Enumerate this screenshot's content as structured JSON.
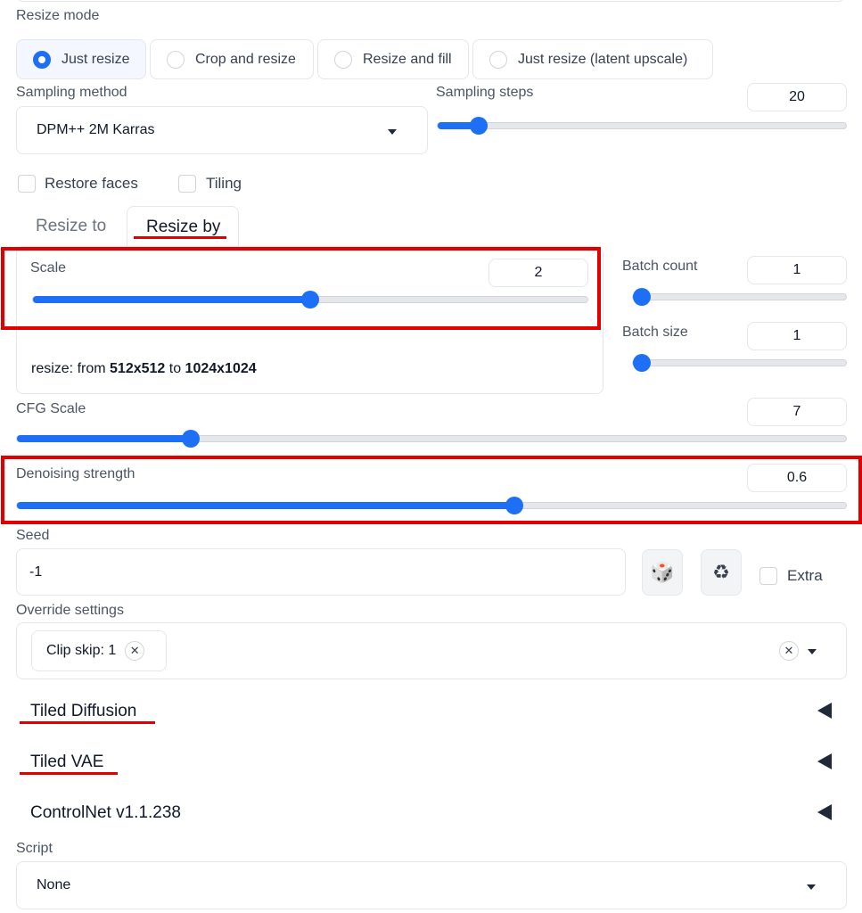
{
  "resize_mode": {
    "label": "Resize mode",
    "options": [
      "Just resize",
      "Crop and resize",
      "Resize and fill",
      "Just resize (latent upscale)"
    ],
    "selected_index": 0
  },
  "sampling_method": {
    "label": "Sampling method",
    "value": "DPM++ 2M Karras"
  },
  "sampling_steps": {
    "label": "Sampling steps",
    "value": "20",
    "fraction": 0.1
  },
  "checkboxes": {
    "restore_faces": "Restore faces",
    "tiling": "Tiling"
  },
  "resize_tabs": {
    "tab1": "Resize to",
    "tab2": "Resize by",
    "active": "Resize by"
  },
  "scale": {
    "label": "Scale",
    "value": "2",
    "fraction": 0.5
  },
  "resize_info": {
    "prefix": "resize: from ",
    "from": "512x512",
    "mid": " to ",
    "to": "1024x1024"
  },
  "batch_count": {
    "label": "Batch count",
    "value": "1",
    "fraction": 0.0
  },
  "batch_size": {
    "label": "Batch size",
    "value": "1",
    "fraction": 0.0
  },
  "cfg_scale": {
    "label": "CFG Scale",
    "value": "7",
    "fraction": 0.21
  },
  "denoising": {
    "label": "Denoising strength",
    "value": "0.6",
    "fraction": 0.6
  },
  "seed": {
    "label": "Seed",
    "value": "-1",
    "dice_icon": "🎲",
    "recycle_icon": "♻"
  },
  "extra": {
    "label": "Extra"
  },
  "override": {
    "label": "Override settings",
    "tag": "Clip skip: 1",
    "tag_remove": "✕",
    "clear": "✕"
  },
  "accordions": [
    "Tiled Diffusion",
    "Tiled VAE",
    "ControlNet v1.1.238"
  ],
  "script": {
    "label": "Script",
    "value": "None"
  },
  "colors": {
    "accent": "#1d6ff5",
    "highlight": "#e00000"
  }
}
